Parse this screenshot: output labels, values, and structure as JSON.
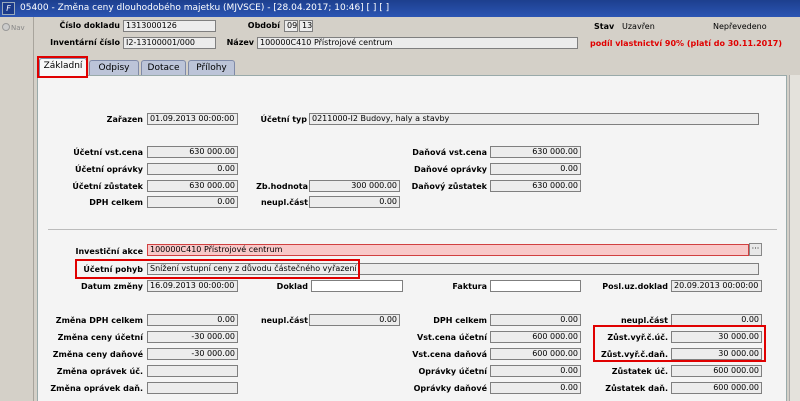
{
  "window": {
    "title": "05400 - Změna ceny dlouhodobého majetku (MJVSCE) - [28.04.2017; 10:46]  [ ]  [ ]",
    "app_icon": "F"
  },
  "nav": {
    "label": "Nav"
  },
  "header": {
    "cislo_dokladu_label": "Číslo dokladu",
    "cislo_dokladu": "1313000126",
    "obdobi_label": "Období",
    "obdobi_1": "09",
    "obdobi_2": "13",
    "stav_label": "Stav",
    "stav_value": "Uzavřen",
    "prevod_value": "Nepřevedeno",
    "inventarni_cislo_label": "Inventární číslo",
    "inventarni_cislo": "I2-13100001/000",
    "nazev_label": "Název",
    "nazev": "100000C410 Přístrojové centrum",
    "podil_text": "podíl vlastnictví  90% (platí do 30.11.2017)"
  },
  "tabs": [
    {
      "label": "Základní"
    },
    {
      "label": "Odpisy"
    },
    {
      "label": "Dotace"
    },
    {
      "label": "Přílohy"
    }
  ],
  "top": {
    "zarazen_label": "Zařazen",
    "zarazen": "01.09.2013 00:00:00",
    "ucetni_typ_label": "Účetní typ",
    "ucetni_typ": "0211000-I2 Budovy, haly a stavby",
    "ucetni_vst_cena_label": "Účetní vst.cena",
    "ucetni_vst_cena": "630 000.00",
    "danova_vst_cena_label": "Daňová vst.cena",
    "danova_vst_cena": "630 000.00",
    "ucetni_opravky_label": "Účetní oprávky",
    "ucetni_opravky": "0.00",
    "danove_opravky_label": "Daňové oprávky",
    "danove_opravky": "0.00",
    "ucetni_zustatek_label": "Účetní zůstatek",
    "ucetni_zustatek": "630 000.00",
    "zb_hodnota_label": "Zb.hodnota",
    "zb_hodnota": "300 000.00",
    "danovy_zustatek_label": "Daňový zůstatek",
    "danovy_zustatek": "630 000.00",
    "dph_celkem_label": "DPH celkem",
    "dph_celkem": "0.00",
    "neupl_cast_label": "neupl.část",
    "neupl_cast": "0.00"
  },
  "bottom": {
    "investicni_akce_label": "Investiční akce",
    "investicni_akce": "100000C410 Přístrojové centrum",
    "dots": "···",
    "ucetni_pohyb_label": "Účetní pohyb",
    "ucetni_pohyb": "Snížení vstupní ceny z důvodu částečného vyřazení",
    "datum_zmeny_label": "Datum změny",
    "datum_zmeny": "16.09.2013 00:00:00",
    "doklad_label": "Doklad",
    "doklad": "",
    "faktura_label": "Faktura",
    "faktura": "",
    "posl_uz_doklad_label": "Posl.uz.doklad",
    "posl_uz_doklad": "20.09.2013 00:00:00",
    "zmena_dph_celkem_label": "Změna DPH celkem",
    "zmena_dph_celkem": "0.00",
    "neupl_cast_label": "neupl.část",
    "neupl_cast": "0.00",
    "dph_celkem_label": "DPH celkem",
    "dph_celkem": "0.00",
    "neupl_cast2_label": "neupl.část",
    "neupl_cast2": "0.00",
    "zmena_ceny_ucetni_label": "Změna ceny účetní",
    "zmena_ceny_ucetni": "-30 000.00",
    "vst_cena_ucetni_label": "Vst.cena účetní",
    "vst_cena_ucetni": "600 000.00",
    "zust_vyr_c_uc_label": "Zůst.vyř.č.úč.",
    "zust_vyr_c_uc": "30 000.00",
    "zmena_ceny_danove_label": "Změna ceny daňové",
    "zmena_ceny_danove": "-30 000.00",
    "vst_cena_danova_label": "Vst.cena daňová",
    "vst_cena_danova": "600 000.00",
    "zust_vyr_c_dan_label": "Zůst.vyř.č.daň.",
    "zust_vyr_c_dan": "30 000.00",
    "zmena_opravek_uc_label": "Změna oprávek úč.",
    "zmena_opravek_uc": "",
    "opravky_ucetni_label": "Oprávky účetní",
    "opravky_ucetni": "0.00",
    "zustatek_uc_label": "Zůstatek úč.",
    "zustatek_uc": "600 000.00",
    "zmena_opravek_dan_label": "Změna oprávek daň.",
    "zmena_opravek_dan": "",
    "opravky_danove_label": "Oprávky daňové",
    "opravky_danove": "0.00",
    "zustatek_dan_label": "Zůstatek daň.",
    "zustatek_dan": "600 000.00"
  }
}
